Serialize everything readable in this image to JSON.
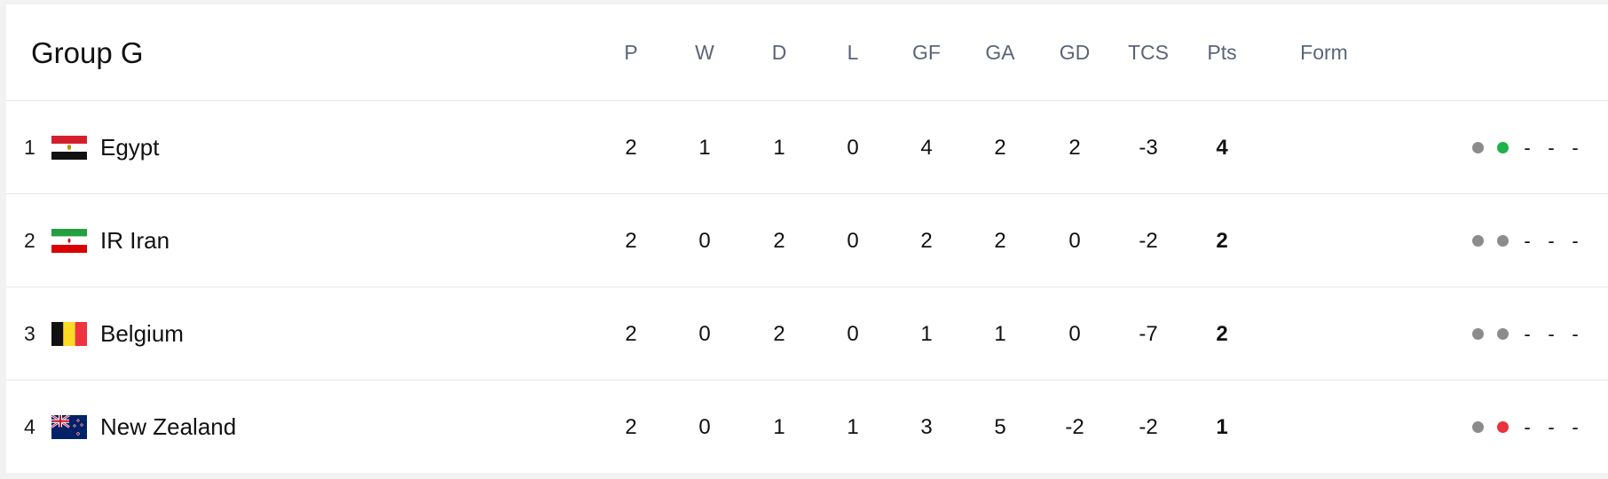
{
  "group": {
    "title": "Group G"
  },
  "columns": [
    "P",
    "W",
    "D",
    "L",
    "GF",
    "GA",
    "GD",
    "TCS",
    "Pts",
    "Form"
  ],
  "colors": {
    "form_draw": "#8c8c8c",
    "form_win": "#1fb14a",
    "form_loss": "#e8323c",
    "header_text": "#5b6478",
    "row_border": "#e6e6e6"
  },
  "teams": [
    {
      "pos": "1",
      "name": "Egypt",
      "flag_icon": "egypt-flag-icon",
      "stats": [
        "2",
        "1",
        "1",
        "0",
        "4",
        "2",
        "2",
        "-3",
        "4"
      ],
      "form": [
        "draw",
        "win"
      ],
      "form_pending": [
        "-",
        "-",
        "-"
      ]
    },
    {
      "pos": "2",
      "name": "IR Iran",
      "flag_icon": "iran-flag-icon",
      "stats": [
        "2",
        "0",
        "2",
        "0",
        "2",
        "2",
        "0",
        "-2",
        "2"
      ],
      "form": [
        "draw",
        "draw"
      ],
      "form_pending": [
        "-",
        "-",
        "-"
      ]
    },
    {
      "pos": "3",
      "name": "Belgium",
      "flag_icon": "belgium-flag-icon",
      "stats": [
        "2",
        "0",
        "2",
        "0",
        "1",
        "1",
        "0",
        "-7",
        "2"
      ],
      "form": [
        "draw",
        "draw"
      ],
      "form_pending": [
        "-",
        "-",
        "-"
      ]
    },
    {
      "pos": "4",
      "name": "New Zealand",
      "flag_icon": "new-zealand-flag-icon",
      "stats": [
        "2",
        "0",
        "1",
        "1",
        "3",
        "5",
        "-2",
        "-2",
        "1"
      ],
      "form": [
        "draw",
        "loss"
      ],
      "form_pending": [
        "-",
        "-",
        "-"
      ]
    }
  ]
}
